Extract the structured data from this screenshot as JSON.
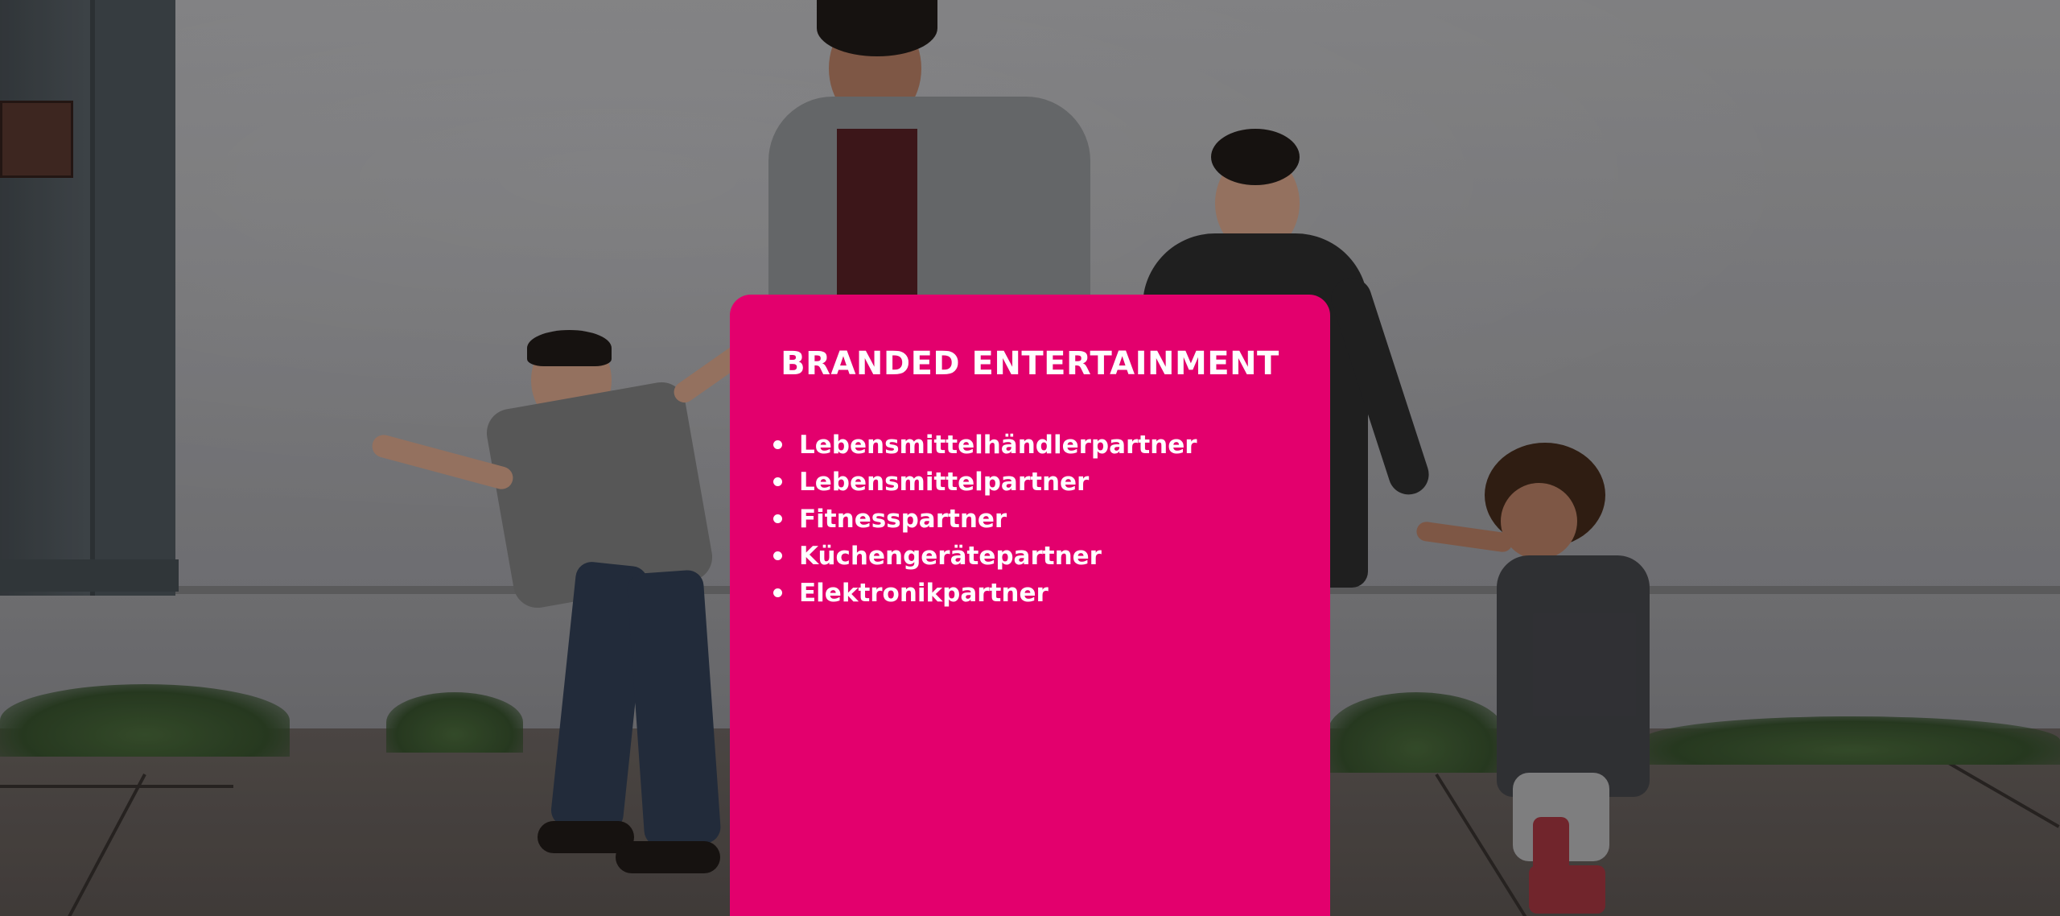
{
  "background": {
    "image_name": "family-walking-photo",
    "description_icon": "photo-background"
  },
  "card": {
    "title": "BRANDED ENTERTAINMENT",
    "color": "#e3006d",
    "items": [
      {
        "label": "Lebensmittelhändlerpartner"
      },
      {
        "label": "Lebensmittelpartner"
      },
      {
        "label": "Fitnesspartner"
      },
      {
        "label": "Küchengerätepartner"
      },
      {
        "label": "Elektronikpartner"
      }
    ]
  }
}
